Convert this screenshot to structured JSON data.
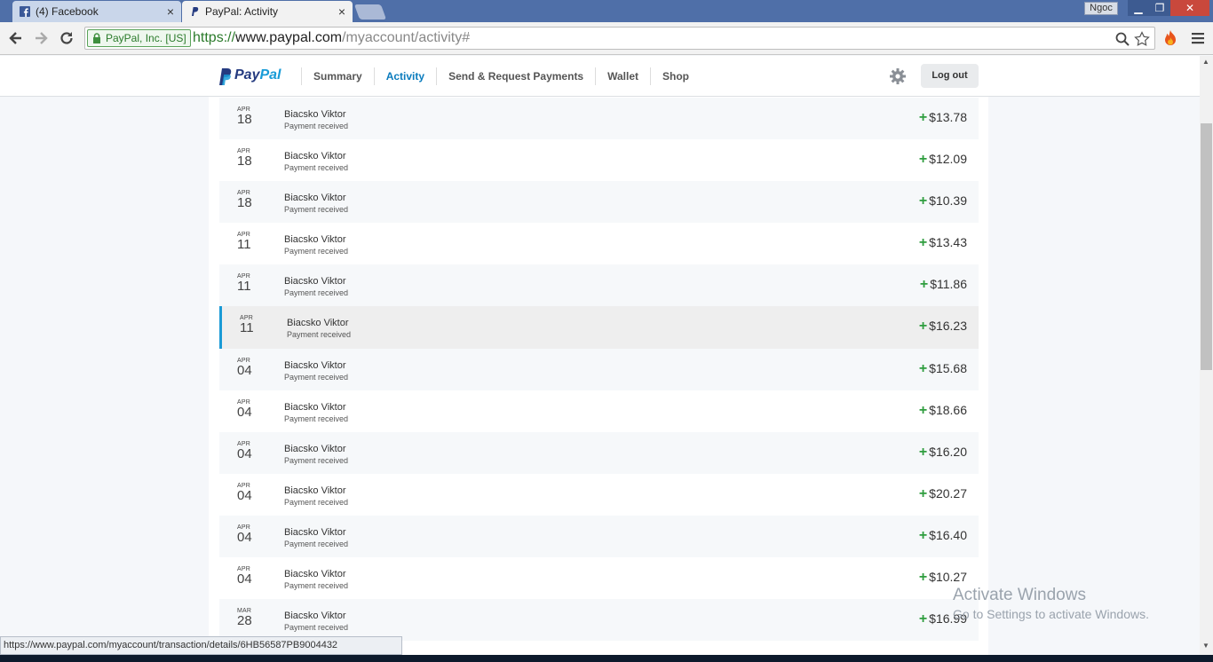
{
  "browser": {
    "tabs": [
      {
        "title": "(4) Facebook",
        "close": "×"
      },
      {
        "title": "PayPal: Activity",
        "close": "×"
      }
    ],
    "user_badge": "Ngoc",
    "window_buttons": {
      "minimize": "▁",
      "maximize": "❐",
      "close": "✕"
    },
    "ev_label": "PayPal, Inc. [US]",
    "url": {
      "scheme": "https://",
      "host": "www.paypal.com",
      "path": "/myaccount/activity#"
    },
    "status_url": "https://www.paypal.com/myaccount/transaction/details/6HB56587PB9004432"
  },
  "paypal": {
    "logo": {
      "part1": "Pay",
      "part2": "Pal"
    },
    "nav": [
      "Summary",
      "Activity",
      "Send & Request Payments",
      "Wallet",
      "Shop"
    ],
    "active_nav": "Activity",
    "logout_label": "Log out"
  },
  "transactions": [
    {
      "month": "APR",
      "day": "18",
      "name": "Biacsko Viktor",
      "status": "Payment received",
      "amount": "$13.78"
    },
    {
      "month": "APR",
      "day": "18",
      "name": "Biacsko Viktor",
      "status": "Payment received",
      "amount": "$12.09"
    },
    {
      "month": "APR",
      "day": "18",
      "name": "Biacsko Viktor",
      "status": "Payment received",
      "amount": "$10.39"
    },
    {
      "month": "APR",
      "day": "11",
      "name": "Biacsko Viktor",
      "status": "Payment received",
      "amount": "$13.43"
    },
    {
      "month": "APR",
      "day": "11",
      "name": "Biacsko Viktor",
      "status": "Payment received",
      "amount": "$11.86"
    },
    {
      "month": "APR",
      "day": "11",
      "name": "Biacsko Viktor",
      "status": "Payment received",
      "amount": "$16.23"
    },
    {
      "month": "APR",
      "day": "04",
      "name": "Biacsko Viktor",
      "status": "Payment received",
      "amount": "$15.68"
    },
    {
      "month": "APR",
      "day": "04",
      "name": "Biacsko Viktor",
      "status": "Payment received",
      "amount": "$18.66"
    },
    {
      "month": "APR",
      "day": "04",
      "name": "Biacsko Viktor",
      "status": "Payment received",
      "amount": "$16.20"
    },
    {
      "month": "APR",
      "day": "04",
      "name": "Biacsko Viktor",
      "status": "Payment received",
      "amount": "$20.27"
    },
    {
      "month": "APR",
      "day": "04",
      "name": "Biacsko Viktor",
      "status": "Payment received",
      "amount": "$16.40"
    },
    {
      "month": "APR",
      "day": "04",
      "name": "Biacsko Viktor",
      "status": "Payment received",
      "amount": "$10.27"
    },
    {
      "month": "MAR",
      "day": "28",
      "name": "Biacsko Viktor",
      "status": "Payment received",
      "amount": "$16.99"
    }
  ],
  "selected_transaction_index": 5,
  "amount_prefix": "+",
  "watermark": {
    "title": "Activate Windows",
    "subtitle": "Go to Settings to activate Windows."
  },
  "colors": {
    "accent": "#1a9ad6",
    "positive": "#2e9d3e",
    "paypal_dark": "#253b80",
    "paypal_light": "#179bd7"
  }
}
